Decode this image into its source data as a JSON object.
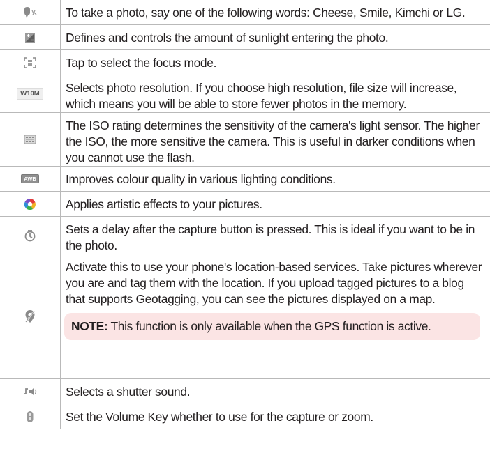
{
  "rows": [
    {
      "icon": "voice-shutter-icon",
      "text": "To take a photo, say one of the following words: Cheese, Smile, Kimchi or LG."
    },
    {
      "icon": "brightness-icon",
      "text": "Defines and controls the amount of sunlight entering the photo."
    },
    {
      "icon": "focus-icon",
      "text": "Tap to select the focus mode."
    },
    {
      "icon": "resolution-icon",
      "icon_label": "W10M",
      "text": "Selects photo resolution. If you choose high resolution, file size will increase, which means you will be able to store fewer photos in the memory."
    },
    {
      "icon": "iso-icon",
      "text": "The ISO rating determines the sensitivity of the camera's light sensor. The higher the ISO, the more sensitive the camera. This is useful in darker conditions when you cannot use the flash."
    },
    {
      "icon": "white-balance-icon",
      "icon_label": "AWB",
      "text": "Improves colour quality in various lighting conditions."
    },
    {
      "icon": "color-effect-icon",
      "text": "Applies artistic effects to your pictures."
    },
    {
      "icon": "timer-icon",
      "text": "Sets a delay after the capture button is pressed. This is ideal if you want to be in the photo."
    },
    {
      "icon": "geotag-icon",
      "text": "Activate this to use your phone's location-based services. Take pictures wherever you are and tag them with the location. If you upload tagged pictures to a blog that supports Geotagging, you can see the pictures displayed on a map.",
      "note_label": "NOTE:",
      "note_text": " This function is only available when the GPS function is active."
    },
    {
      "icon": "shutter-sound-icon",
      "text": "Selects a shutter sound."
    },
    {
      "icon": "volume-key-icon",
      "text": "Set the Volume Key whether to use for the capture or zoom."
    }
  ]
}
